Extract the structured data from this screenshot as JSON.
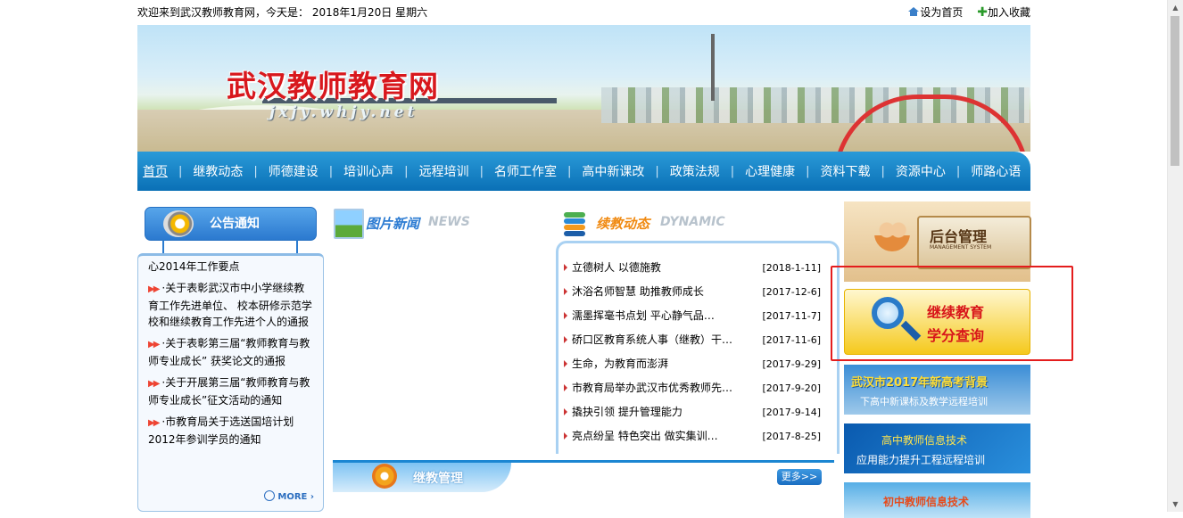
{
  "topbar": {
    "welcome": "欢迎来到武汉教师教育网，今天是： 2018年1月20日 星期六",
    "set_home": "设为首页",
    "add_fav": "加入收藏"
  },
  "banner": {
    "title": "武汉教师教育网",
    "subtitle": "jxjy.whjy.net"
  },
  "nav": {
    "items": [
      "首页",
      "继教动态",
      "师德建设",
      "培训心声",
      "远程培训",
      "名师工作室",
      "高中新课改",
      "政策法规",
      "心理健康",
      "资料下载",
      "资源中心",
      "师路心语"
    ]
  },
  "notice": {
    "title": "公告通知",
    "partial": "心2014年工作要点",
    "items": [
      "·关于表彰武汉市中小学继续教育工作先进单位、 校本研修示范学校和继续教育工作先进个人的通报",
      "·关于表彰第三届“教师教育与教师专业成长” 获奖论文的通报",
      "·关于开展第三届“教师教育与教师专业成长”征文活动的通知",
      "·市教育局关于选送国培计划2012年参训学员的通知"
    ],
    "more": "MORE ›"
  },
  "picnews": {
    "cn": "图片新闻",
    "en": "NEWS"
  },
  "dynamic": {
    "cn": "续教动态",
    "en": "DYNAMIC",
    "rows": [
      {
        "title": "立德树人 以德施教",
        "date": "[2018-1-11]"
      },
      {
        "title": "沐浴名师智慧 助推教师成长",
        "date": "[2017-12-6]"
      },
      {
        "title": "濡墨挥毫书点划 平心静气品…",
        "date": "[2017-11-7]"
      },
      {
        "title": "硚口区教育系统人事（继教）干…",
        "date": "[2017-11-6]"
      },
      {
        "title": "生命，为教育而澎湃",
        "date": "[2017-9-29]"
      },
      {
        "title": "市教育局举办武汉市优秀教师先…",
        "date": "[2017-9-20]"
      },
      {
        "title": "撬抉引领 提升管理能力",
        "date": "[2017-9-14]"
      },
      {
        "title": "亮点纷呈 特色突出 做实集训…",
        "date": "[2017-8-25]"
      }
    ]
  },
  "management": {
    "title": "继教管理",
    "more": "更多>>"
  },
  "right": {
    "admin_title": "后台管理",
    "admin_sub": "MANAGEMENT SYSTEM",
    "credit_l1": "继续教育",
    "credit_l2": "学分查询",
    "ad1_a": "武汉市2017年新高考背景",
    "ad1_b": "下高中新课标及教学远程培训",
    "ad2_a": "高中教师信息技术",
    "ad2_b": "应用能力提升工程远程培训",
    "ad3_a": "初中教师信息技术"
  },
  "colors": {
    "nav_blue": "#0a70b6",
    "title_red": "#d8181d",
    "highlight_red": "#e41d1d"
  }
}
